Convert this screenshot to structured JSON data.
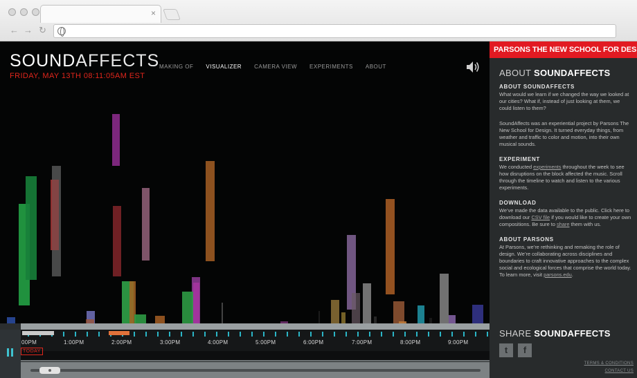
{
  "browser": {
    "tab_close": "×",
    "back_glyph": "←",
    "forward_glyph": "→",
    "reload_glyph": "↻"
  },
  "site": {
    "logo": {
      "strong": "SOUND",
      "light": "AFFECTS"
    },
    "datetime": "FRIDAY, MAY 13TH 08:11:05AM EST",
    "nav": [
      "MAKING OF",
      "VISUALIZER",
      "CAMERA VIEW",
      "EXPERIMENTS",
      "ABOUT"
    ],
    "nav_active": "VISUALIZER",
    "speaker_icon": "speaker-volume-icon",
    "visualizer": {
      "bars": [
        {
          "c": "#23a145"
        },
        {
          "c": "#17803a"
        },
        {
          "c": "#b03a3a"
        },
        {
          "c": "#777"
        },
        {
          "c": "#7b2c2c"
        },
        {
          "c": "#8a2b8a"
        },
        {
          "c": "#7b2428"
        },
        {
          "c": "#8c5d74"
        },
        {
          "c": "#9c5a22"
        },
        {
          "c": "#2d9a44"
        },
        {
          "c": "#a36424"
        },
        {
          "c": "#2d9a44"
        },
        {
          "c": "#8a3890"
        },
        {
          "c": "#2d9a44"
        },
        {
          "c": "#a5349f"
        },
        {
          "c": "#9c5a22"
        },
        {
          "c": "#6b6bb2"
        },
        {
          "c": "#a0532a"
        },
        {
          "c": "#8c6aa0"
        },
        {
          "c": "#856a34"
        },
        {
          "c": "#6a5a64"
        },
        {
          "c": "#7e7e7e"
        },
        {
          "c": "#a35a24"
        },
        {
          "c": "#8c5232"
        },
        {
          "c": "#7d7d7d"
        },
        {
          "c": "#bf7a3a"
        },
        {
          "c": "#6c2f6a"
        },
        {
          "c": "#1f8fa0"
        },
        {
          "c": "#2a4a9c"
        },
        {
          "c": "#3a3a9a"
        },
        {
          "c": "#7f5fa0"
        },
        {
          "c": "#806a2a"
        },
        {
          "c": "#4a4a4a"
        },
        {
          "c": "#1f1f1f"
        },
        {
          "c": "#2a2a2a"
        },
        {
          "c": "#1b1b1b"
        }
      ]
    },
    "timeline": {
      "hours": [
        "00PM",
        "1:00PM",
        "2:00PM",
        "3:00PM",
        "4:00PM",
        "5:00PM",
        "6:00PM",
        "7:00PM",
        "8:00PM",
        "9:00PM"
      ],
      "today": "TODAY",
      "pause_icon": "pause-icon"
    }
  },
  "sidebar": {
    "brand": "PARSONS THE NEW SCHOOL FOR DESIGN",
    "about_title": {
      "light": "ABOUT ",
      "strong": "SOUNDAFFECTS"
    },
    "sections": [
      {
        "heading": "ABOUT SOUNDAFFECTS",
        "paragraphs": [
          "What would we learn if we changed the way we looked at our cities? What if, instead of just looking at them, we could listen to them?",
          "SoundAffects was an experiential project by Parsons The New School for Design. It turned everyday things, from weather and traffic to color and motion, into their own musical sounds."
        ]
      },
      {
        "heading": "EXPERIMENT",
        "pre": "We conducted ",
        "link": "experiments",
        "post": " throughout the week to see how disruptions on the block affected the music. Scroll through the timeline to watch and listen to the various experiments."
      },
      {
        "heading": "DOWNLOAD",
        "pre": "We’ve made the data available to the public. Click here to download our ",
        "link": "CSV file",
        "mid": " if you would like to create your own compositions. Be sure to ",
        "link2": "share",
        "post": " them with us."
      },
      {
        "heading": "ABOUT PARSONS",
        "pre": "At Parsons, we’re rethinking and remaking the role of design.  We’re collaborating across disciplines and boundaries to craft innovative approaches to the complex social and ecological forces that comprise the world today. To learn more, visit ",
        "link": "parsons.edu",
        "post": "."
      }
    ],
    "share_title": {
      "light": "SHARE ",
      "strong": "SOUNDAFFECTS"
    },
    "social": [
      {
        "icon": "twitter-icon",
        "glyph": "t"
      },
      {
        "icon": "facebook-icon",
        "glyph": "f"
      }
    ],
    "footer": [
      "TERMS & CONDITIONS",
      "CONTACT US"
    ]
  }
}
